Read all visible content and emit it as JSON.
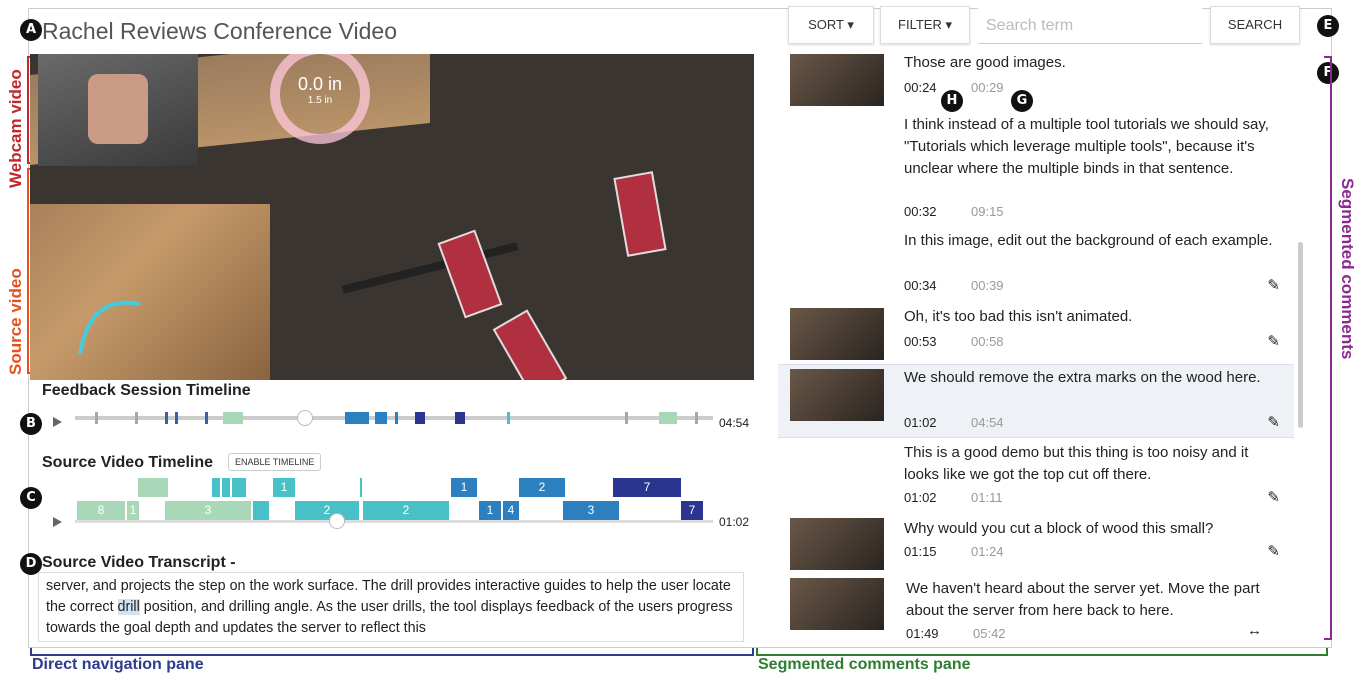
{
  "app_title": "Rachel Reviews Conference Video",
  "annotations": {
    "webcam_video": "Webcam video",
    "source_video": "Source video",
    "segmented_comments": "Segmented comments",
    "direct_navigation_pane": "Direct navigation pane",
    "segmented_comments_pane": "Segmented comments pane",
    "badges": [
      "A",
      "B",
      "C",
      "D",
      "E",
      "F",
      "G",
      "H"
    ]
  },
  "video": {
    "readout_value": "0.0 in",
    "readout_sub": "1.5 in"
  },
  "feedback_timeline": {
    "title": "Feedback Session Timeline",
    "time": "04:54",
    "progress": 0.36
  },
  "source_timeline": {
    "title": "Source Video Timeline",
    "enable_label": "ENABLE TIMELINE",
    "time": "01:02",
    "progress": 0.41,
    "segment_labels": [
      "1",
      "1",
      "2",
      "7",
      "8",
      "1",
      "3",
      "2",
      "2",
      "1",
      "4",
      "3",
      "7"
    ]
  },
  "transcript": {
    "title": "Source Video Transcript -",
    "before": "server, and projects the step on the work surface. The drill provides interactive guides to help the user locate the correct ",
    "highlight": "drill",
    "after": " position, and drilling angle. As the user drills, the tool displays feedback of the users progress towards the goal depth and updates the server to reflect this"
  },
  "toolbar": {
    "sort_label": "SORT ▾",
    "filter_label": "FILTER ▾",
    "search_placeholder": "Search term",
    "search_button": "SEARCH"
  },
  "comments": [
    {
      "text": "Those are good images.",
      "t1": "00:24",
      "t2": "00:29",
      "thumb": true,
      "edit": false
    },
    {
      "text": "I think instead of a multiple tool tutorials we should say, \"Tutorials which leverage multiple tools\", because it's unclear where the multiple binds in that sentence.",
      "t1": "00:32",
      "t2": "09:15",
      "thumb": false,
      "edit": false
    },
    {
      "text": "In this image, edit out the background of each example.",
      "t1": "00:34",
      "t2": "00:39",
      "thumb": false,
      "edit": true
    },
    {
      "text": "Oh, it's too bad this isn't animated.",
      "t1": "00:53",
      "t2": "00:58",
      "thumb": true,
      "edit": true
    },
    {
      "text": "We should remove the extra marks on the wood here.",
      "t1": "01:02",
      "t2": "04:54",
      "thumb": true,
      "edit": true,
      "selected": true
    },
    {
      "text": "This is a good demo but this thing is too noisy and it looks like we got the top cut off there.",
      "t1": "01:02",
      "t2": "01:11",
      "thumb": false,
      "edit": true
    },
    {
      "text": "Why would you cut a block of wood this small?",
      "t1": "01:15",
      "t2": "01:24",
      "thumb": true,
      "edit": true
    },
    {
      "text": "We haven't heard about the server yet. Move the part about the server from here back to here.",
      "t1": "01:49",
      "t2": "05:42",
      "thumb": true,
      "edit": false,
      "resize": true
    }
  ],
  "colors": {
    "webcam_label": "#c0282d",
    "source_label": "#e8501e",
    "segmented_label": "#8a2a8e",
    "direct_nav": "#2e3a8c",
    "segmented_pane": "#2e7d32",
    "seg_light": "#a8d8b8",
    "seg_teal": "#48c0c8",
    "seg_blue": "#2c80c0",
    "seg_dark": "#2a3590"
  }
}
